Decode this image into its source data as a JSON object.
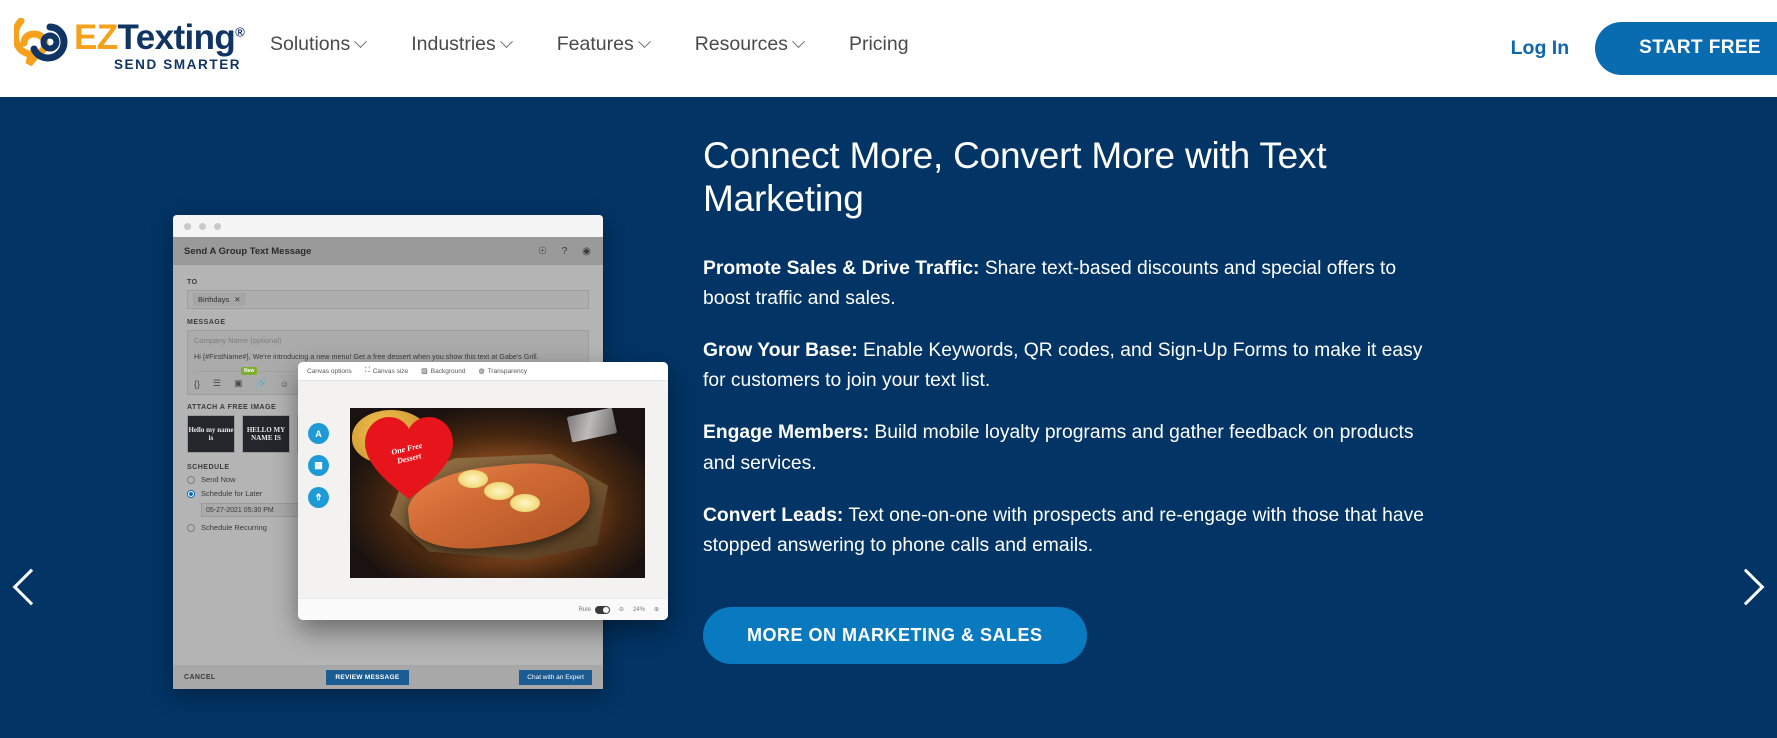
{
  "brand": {
    "name_part1": "EZ",
    "name_part2": "Texting",
    "registered": "®",
    "tagline": "SEND SMARTER",
    "orange": "#f5a11b",
    "navy": "#103463"
  },
  "header": {
    "nav": [
      {
        "label": "Solutions",
        "has_caret": true
      },
      {
        "label": "Industries",
        "has_caret": true
      },
      {
        "label": "Features",
        "has_caret": true
      },
      {
        "label": "Resources",
        "has_caret": true
      },
      {
        "label": "Pricing",
        "has_caret": false
      }
    ],
    "login_label": "Log In",
    "start_free_label": "START FREE",
    "accent": "#0a6cb0"
  },
  "hero": {
    "background": "#023465",
    "title": "Connect More, Convert More with Text Marketing",
    "paragraphs": [
      {
        "lead": "Promote Sales & Drive Traffic:",
        "body": " Share text-based discounts and special offers to boost traffic and sales."
      },
      {
        "lead": "Grow Your Base:",
        "body": " Enable Keywords, QR codes, and Sign-Up Forms to make it easy for customers to join your text list."
      },
      {
        "lead": "Engage Members:",
        "body": " Build mobile loyalty programs and gather feedback on products and services."
      },
      {
        "lead": "Convert Leads:",
        "body": " Text one-on-one with prospects and re-engage with those that have stopped answering to phone calls and emails."
      }
    ],
    "cta_label": "MORE ON MARKETING & SALES",
    "cta_color": "#0a7ac0",
    "prev_arrow": "chevron-left",
    "next_arrow": "chevron-right"
  },
  "mockup": {
    "app_title": "Send A Group Text Message",
    "top_icons": [
      "bell-icon",
      "help-icon",
      "account-icon"
    ],
    "to_label": "TO",
    "to_chip": "Birthdays",
    "to_chip_remove": "✕",
    "message_label": "MESSAGE",
    "company_placeholder": "Company Name (optional)",
    "message_body": "Hi {#FirstName#}, We're introducing a new menu! Get a free dessert when you show this text at Gabe's Grill.",
    "tool_badge": "New",
    "attach_label": "ATTACH A FREE IMAGE",
    "thumbs": [
      "Hello my name is",
      "HELLO MY NAME IS",
      "HELLO MY NAME IS"
    ],
    "schedule_label": "SCHEDULE",
    "schedule_options": [
      {
        "label": "Send Now",
        "selected": false
      },
      {
        "label": "Schedule for Later",
        "selected": true
      }
    ],
    "schedule_date": "05-27-2021 05:30 PM",
    "recurring_label": "Schedule Recurring",
    "cancel_label": "CANCEL",
    "review_label": "REVIEW MESSAGE",
    "chat_label": "Chat with an Expert"
  },
  "canvas_editor": {
    "toolbar": [
      {
        "icon": "",
        "label": "Canvas options"
      },
      {
        "icon": "⛶",
        "label": "Canvas size"
      },
      {
        "icon": "▨",
        "label": "Background"
      },
      {
        "icon": "◍",
        "label": "Transparency"
      }
    ],
    "side_tools": [
      {
        "icon": "A",
        "name": "text-tool"
      },
      {
        "icon": "▦",
        "name": "grid-tool"
      },
      {
        "icon": "⇮",
        "name": "upload-tool"
      }
    ],
    "sticker_line1": "One Free",
    "sticker_line2": "Dessert",
    "footer_rule_label": "Rule",
    "footer_zoom": "24%",
    "footer_zoom_out": "⊖",
    "footer_zoom_in": "⊕"
  }
}
